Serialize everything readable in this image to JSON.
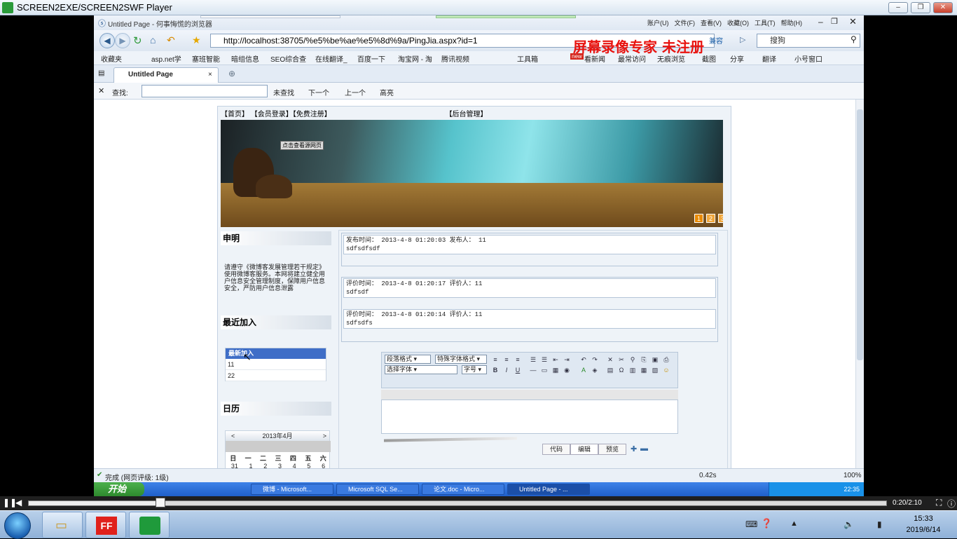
{
  "player": {
    "title": "SCREEN2EXE/SCREEN2SWF Player",
    "time": "0:20/2:10",
    "progress": 0.154,
    "watermark": "屏幕录像专家  未注册"
  },
  "browser": {
    "title": "Untitled Page - 何事悔慌的浏览器",
    "menu": [
      "账户(U)",
      "文件(F)",
      "查看(V)",
      "收藏(O)",
      "工具(T)",
      "帮助(H)"
    ],
    "url": "http://localhost:38705/%e5%be%ae%e5%8d%9a/PingJia.aspx?id=1",
    "compat": "兼容",
    "search_placeholder": "搜狗",
    "favorites": [
      "收藏夹",
      "asp.net学",
      "塞班智能",
      "暗组信息",
      "SEO综合查",
      "在线翻译_",
      "百度一下",
      "淘宝网 - 淘",
      "腾讯视频"
    ],
    "tools": [
      "工具箱",
      "看新闻",
      "最常访问",
      "无痕浏览",
      "截图",
      "分享",
      "翻译",
      "小号窗口"
    ],
    "new_badge": "new",
    "tab": "Untitled Page",
    "find": {
      "label": "查找:",
      "value": "",
      "search": "未查找",
      "next": "下一个",
      "prev": "上一个",
      "highlight": "高亮"
    },
    "status": {
      "left": "完成 (网页评级: 1级)",
      "speed": "0.42s",
      "zoom": "100%"
    }
  },
  "site": {
    "nav": [
      "【首页】",
      "【会员登录】",
      "【免费注册】",
      "【后台管理】"
    ],
    "banner_link": "点击查看源网页",
    "banner_pages": [
      "1",
      "2",
      "3"
    ],
    "sidebar": {
      "decl_title": "申明",
      "decl_text": "请遵守《微博客发展管理若干规定》使用微博客服务。本网将建立健全用户信息安全管理制度，保障用户信息安全，严防用户信息泄露",
      "recent_title": "最近加入",
      "recent_header": "最新加入",
      "recent_items": [
        "11",
        "22"
      ],
      "cal_title": "日历",
      "cal_month": "2013年4月",
      "cal_prev": "<",
      "cal_next": ">",
      "weekdays": [
        "日",
        "一",
        "二",
        "三",
        "四",
        "五",
        "六"
      ],
      "dates": [
        "31",
        "1",
        "2",
        "3",
        "4",
        "5",
        "6"
      ]
    },
    "post": {
      "meta": "发布时间： 2013-4-8 01:20:03 发布人： 11",
      "body": "sdfsdfsdf"
    },
    "comments": [
      {
        "meta": "评价时间： 2013-4-8 01:20:17 评价人：11",
        "body": "sdfsdf"
      },
      {
        "meta": "评价时间： 2013-4-8 01:20:14 评价人：11",
        "body": "sdfsdfs"
      }
    ],
    "editor": {
      "para": "段落格式",
      "style": "特殊字体格式",
      "font": "选择字体",
      "size": "字号",
      "tabs": [
        "代码",
        "编辑",
        "预览"
      ]
    }
  },
  "xp_taskbar": {
    "start": "开始",
    "windows": [
      "微博 - Microsoft...",
      "Microsoft SQL Se...",
      "论文.doc - Micro...",
      "Untitled Page - ..."
    ],
    "time": "22:35"
  },
  "win7": {
    "time": "15:33",
    "date": "2019/6/14"
  }
}
